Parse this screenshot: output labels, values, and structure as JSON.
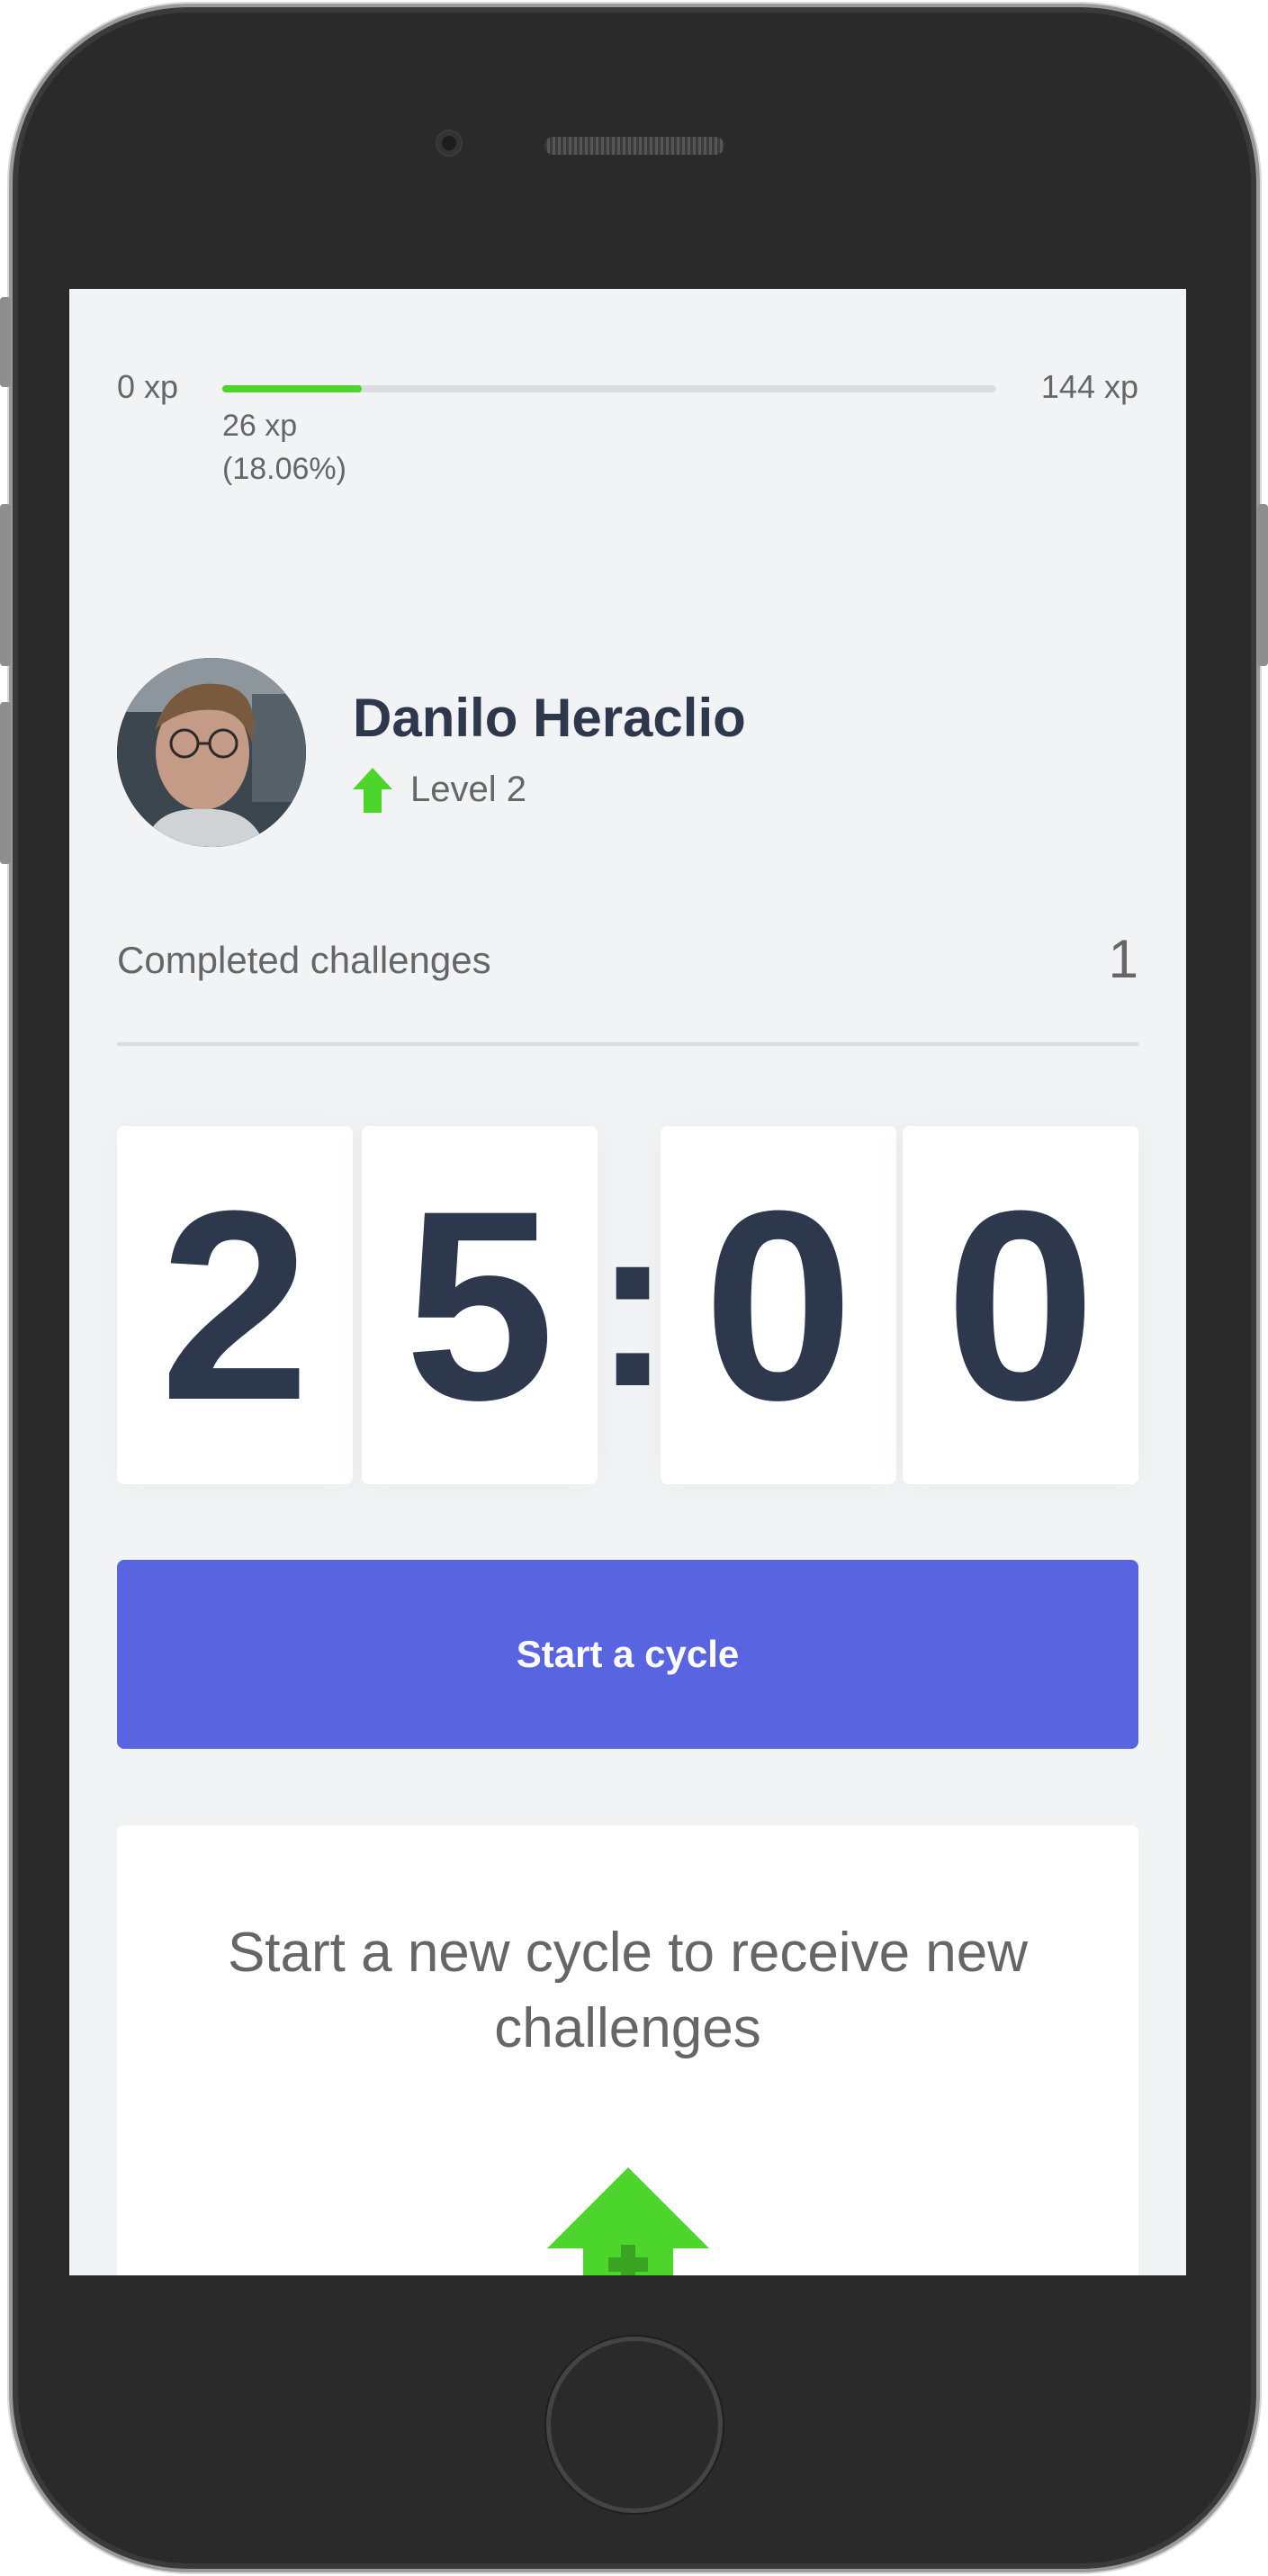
{
  "experience": {
    "min_label": "0 xp",
    "max_label": "144 xp",
    "current_label": "26 xp",
    "percent_label": "(18.06%)",
    "progress_fraction": 0.1806,
    "bar_color": "#4cd62b"
  },
  "profile": {
    "name": "Danilo Heraclio",
    "level_label": "Level 2",
    "level_icon": "level-up-arrow-icon"
  },
  "challenges": {
    "completed_label": "Completed challenges",
    "completed_count": "1"
  },
  "countdown": {
    "minute_left": "2",
    "minute_right": "5",
    "separator": ":",
    "second_left": "0",
    "second_right": "0"
  },
  "start_button": {
    "label": "Start a cycle",
    "color": "#5965e0"
  },
  "challenge_box": {
    "message": "Start a new cycle to receive new challenges",
    "icon": "level-up-icon"
  },
  "colors": {
    "background": "#f2f3f5",
    "title": "#2e384d",
    "text": "#666666",
    "accent_green": "#4cd62b"
  }
}
